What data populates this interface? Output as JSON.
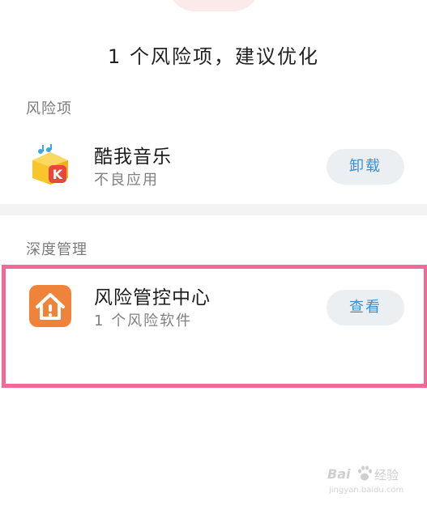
{
  "summary": {
    "text": "1 个风险项，建议优化"
  },
  "risk_section": {
    "label": "风险项",
    "app": {
      "name": "酷我音乐",
      "description": "不良应用",
      "action_label": "卸载",
      "icon": "kuwo-music-icon"
    }
  },
  "deep_section": {
    "label": "深度管理",
    "app": {
      "name": "风险管控中心",
      "description": "1 个风险软件",
      "action_label": "查看",
      "icon": "risk-control-house-icon"
    }
  },
  "watermark": {
    "logo": "Bai",
    "text": "经验",
    "url": "jingyan.baidu.com"
  },
  "colors": {
    "action_text": "#3a8fd6",
    "action_bg": "#eceff1",
    "highlight": "#f06a97",
    "risk_icon": "#f0833a",
    "kuwo_yellow": "#f8c52c",
    "kuwo_badge": "#e8473b"
  }
}
